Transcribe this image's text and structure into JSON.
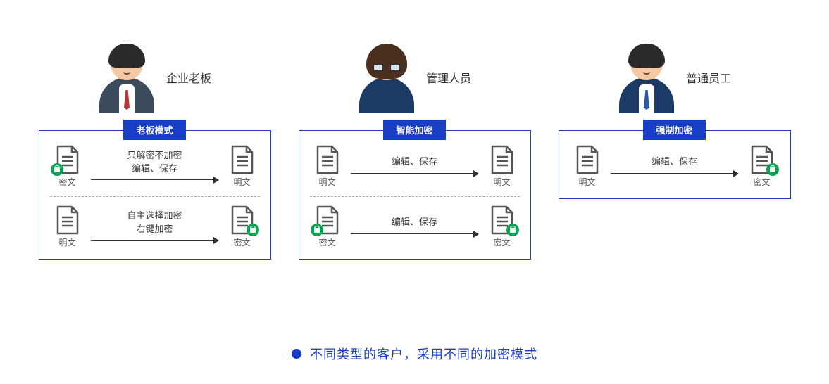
{
  "columns": [
    {
      "persona_label": "企业老板",
      "mode_label": "老板模式",
      "rows": [
        {
          "from_label": "密文",
          "to_label": "明文",
          "line1": "只解密不加密",
          "line2": "编辑、保存",
          "from_lock": "left",
          "to_lock": ""
        },
        {
          "from_label": "明文",
          "to_label": "密文",
          "line1": "自主选择加密",
          "line2": "右键加密",
          "from_lock": "",
          "to_lock": "right"
        }
      ]
    },
    {
      "persona_label": "管理人员",
      "mode_label": "智能加密",
      "rows": [
        {
          "from_label": "明文",
          "to_label": "明文",
          "line1": "编辑、保存",
          "line2": "",
          "from_lock": "",
          "to_lock": ""
        },
        {
          "from_label": "密文",
          "to_label": "密文",
          "line1": "编辑、保存",
          "line2": "",
          "from_lock": "left",
          "to_lock": "right"
        }
      ]
    },
    {
      "persona_label": "普通员工",
      "mode_label": "强制加密",
      "rows": [
        {
          "from_label": "明文",
          "to_label": "密文",
          "line1": "编辑、保存",
          "line2": "",
          "from_lock": "",
          "to_lock": "right"
        }
      ]
    }
  ],
  "caption": "不同类型的客户，采用不同的加密模式"
}
